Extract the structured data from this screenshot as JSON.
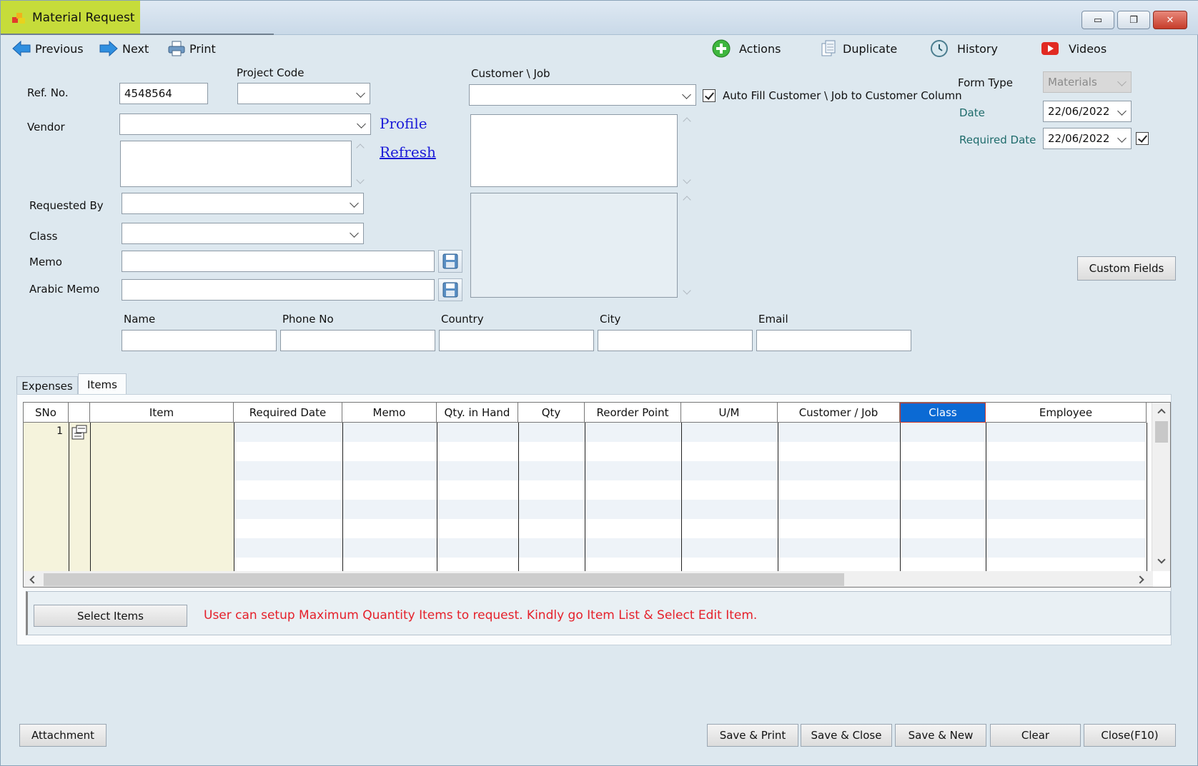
{
  "window": {
    "title": "Material Request",
    "controls": {
      "minimize": "▭",
      "maximize": "❐",
      "close": "✕"
    }
  },
  "toolbar": {
    "previous": "Previous",
    "next": "Next",
    "print": "Print",
    "actions": "Actions",
    "duplicate": "Duplicate",
    "history": "History",
    "videos": "Videos"
  },
  "form": {
    "ref_no_label": "Ref. No.",
    "ref_no_value": "4548564",
    "project_code_label": "Project Code",
    "project_code_value": "",
    "customer_job_label": "Customer \\ Job",
    "customer_job_value": "",
    "auto_fill_label": "Auto Fill Customer \\ Job to Customer Column",
    "auto_fill_checked": true,
    "vendor_label": "Vendor",
    "vendor_value": "",
    "profile_link": "Profile",
    "refresh_link": "Refresh",
    "requested_by_label": "Requested By",
    "requested_by_value": "",
    "class_label": "Class",
    "class_value": "",
    "memo_label": "Memo",
    "memo_value": "",
    "arabic_memo_label": "Arabic Memo",
    "arabic_memo_value": "",
    "form_type_label": "Form Type",
    "form_type_value": "Materials",
    "date_label": "Date",
    "date_value": "22/06/2022",
    "required_date_label": "Required Date",
    "required_date_value": "22/06/2022",
    "required_date_checked": true,
    "custom_fields_button": "Custom Fields"
  },
  "contact": {
    "name_label": "Name",
    "phone_label": "Phone No",
    "country_label": "Country",
    "city_label": "City",
    "email_label": "Email"
  },
  "tabs": [
    {
      "label": "Expenses",
      "active": false
    },
    {
      "label": "Items",
      "active": true
    }
  ],
  "grid": {
    "columns": [
      "SNo",
      "",
      "Item",
      "Required Date",
      "Memo",
      "Qty. in Hand",
      "Qty",
      "Reorder Point",
      "U/M",
      "Customer / Job",
      "Class",
      "Employee"
    ],
    "selected_column": "Class",
    "rows": [
      {
        "sno": "1"
      }
    ]
  },
  "select_items_button": "Select Items",
  "notice": "User can setup Maximum Quantity  Items to request. Kindly go Item List & Select Edit Item.",
  "footer": {
    "attachment": "Attachment",
    "save_print": "Save & Print",
    "save_close": "Save & Close",
    "save_new": "Save & New",
    "clear": "Clear",
    "close": "Close(F10)"
  }
}
